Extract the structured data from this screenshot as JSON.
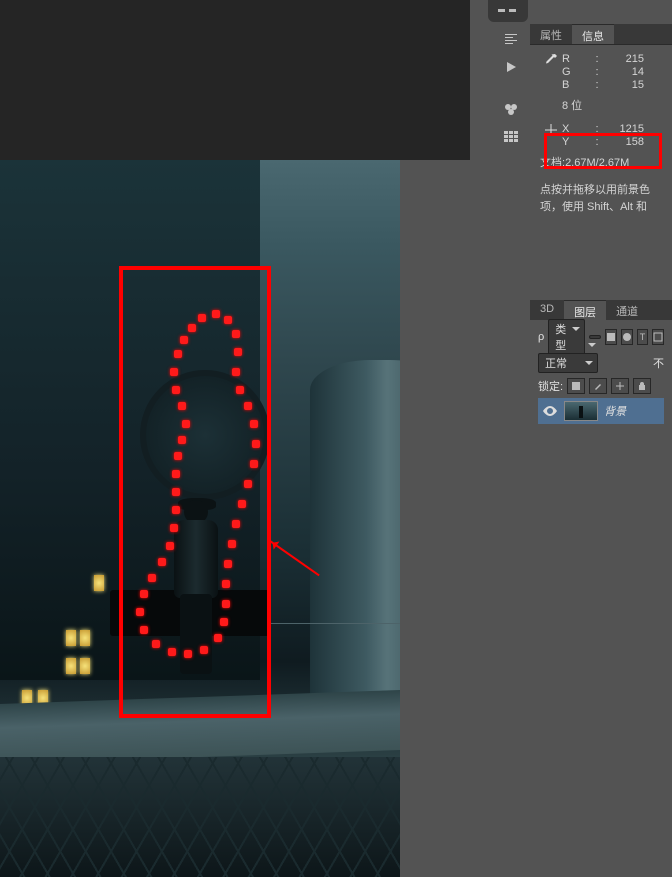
{
  "tabs_info": {
    "properties": "属性",
    "info": "信息"
  },
  "color": {
    "r_label": "R",
    "g_label": "G",
    "b_label": "B",
    "r": "215",
    "g": "14",
    "b": "15",
    "bitdepth": "8 位"
  },
  "pos": {
    "x_label": "X",
    "y_label": "Y",
    "x": "1215",
    "y": "158"
  },
  "doc": {
    "label": "文档",
    "value": "2.67M/2.67M"
  },
  "hint": {
    "line1": "点按并拖移以用前景色",
    "line2": "项，使用 Shift、Alt 和"
  },
  "tabs_layers": {
    "threed": "3D",
    "layers": "图层",
    "channels": "通道"
  },
  "layer_panel": {
    "kind_label": "类型",
    "mode": "正常",
    "opacity_suffix": "不",
    "lock_label": "锁定:"
  },
  "layer": {
    "name": "背景"
  }
}
